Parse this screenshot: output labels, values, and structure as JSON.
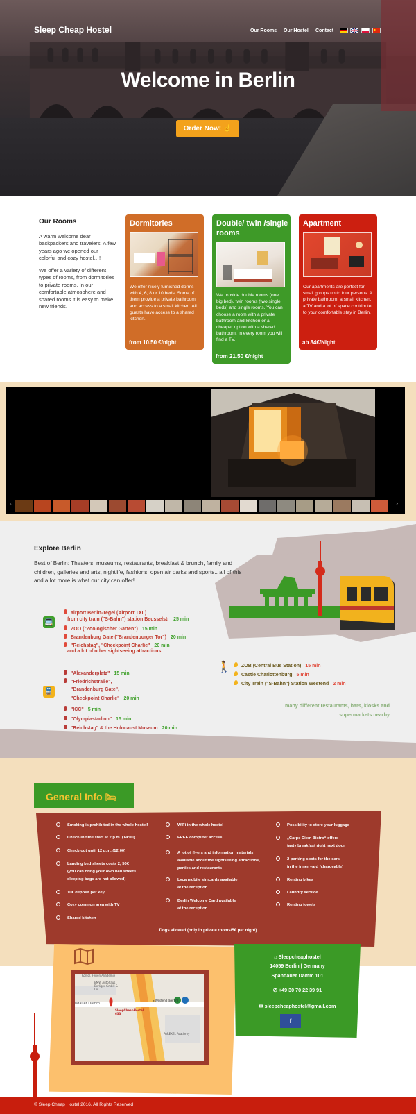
{
  "header": {
    "brand": "Sleep Cheap Hostel",
    "nav": [
      "Our Rooms",
      "Our Hostel",
      "Contact"
    ],
    "flags": [
      {
        "icon": "german-flag-icon",
        "colors": [
          "#000000",
          "#dd0000",
          "#ffce00"
        ]
      },
      {
        "icon": "uk-flag-icon",
        "colors": [
          "#012169",
          "#ffffff",
          "#c8102e"
        ]
      },
      {
        "icon": "polish-flag-icon",
        "colors": [
          "#ffffff",
          "#dc143c"
        ]
      },
      {
        "icon": "chinese-flag-icon",
        "colors": [
          "#de2910",
          "#ffde00"
        ]
      }
    ]
  },
  "hero": {
    "title": "Welcome in Berlin",
    "cta": "Order Now!",
    "cta_icon": "hand-pointer-icon",
    "cta_color": "#f3a21c"
  },
  "rooms": {
    "heading": "Our Rooms",
    "intro_1": "A warm welcome dear backpackers and travelers! A few years ago we opened our colorful and cozy hostel…!",
    "intro_2": "We offer a variety of different types of rooms, from dormitories to private rooms. In our comfortable atmosphere and shared rooms it is easy to make new friends.",
    "cards": [
      {
        "title": "Dormitories",
        "text": "We offer nicely furnished dorms with 4, 6, 8 or 10 beds. Some of them provide a private bathroom and access to a small kitchen. All guests have access to a shared kitchen.",
        "price": "from 10.50 €/night",
        "color": "#d06d28"
      },
      {
        "title": "Double/ twin /single rooms",
        "text": "We provide double rooms (one big bed), twin rooms (two single beds) and single rooms. You can choose a room with a private bathroom and kitchen or a cheaper option with a shared bathroom. In every room you will find a TV.",
        "price": "from 21.50 €/night",
        "color": "#3e9a28"
      },
      {
        "title": "Apartment",
        "text": "Our apartments are perfect for small groups up to four persons. A private bathroom, a small kitchen, a TV and a lot of space contribute to your comfortable stay in Berlin.",
        "price": "ab 84€/Night",
        "color": "#cc1f10"
      }
    ]
  },
  "gallery": {
    "prev_icon": "chevron-left-icon",
    "next_icon": "chevron-right-icon"
  },
  "explore": {
    "heading": "Explore Berlin",
    "text": "Best of Berlin: Theaters, museums, restaurants, breakfast & brunch, family and children, galleries and arts, nightlife, fashions, open air parks and sports.. all of this and a lot more is what our city can offer!",
    "group_a_icon": "bus-icon",
    "group_a": [
      {
        "place": "airport Berlin-Tegel (Airport TXL)",
        "time": ""
      },
      {
        "place": "from city train (\"S-Bahn\") station Beusselstr",
        "time": "25 min"
      },
      {
        "place": "ZOO (\"Zoologischer Garten\")",
        "time": "15 min"
      },
      {
        "place": "Brandenburg Gate (\"Brandenburger Tor\")",
        "time": "20 min"
      },
      {
        "place": "\"Reichstag\", \"Checkpoint Charlie\"",
        "time": "20 min"
      },
      {
        "place": "and a lot of other sightseeing attractions",
        "time": ""
      }
    ],
    "group_b_icon": "train-icon",
    "group_b": [
      {
        "place": "\"Alexanderplatz\"",
        "time": "15 min"
      },
      {
        "place": "\"Friedrichstraße\",",
        "time": ""
      },
      {
        "place": "\"Brandenburg Gate\",",
        "time": ""
      },
      {
        "place": "\"Checkpoint Charlie\"",
        "time": "20 min"
      },
      {
        "place": "\"ICC\"",
        "time": "5 min"
      },
      {
        "place": "\"Olympiastadion\"",
        "time": "15 min"
      },
      {
        "place": "\"Reichstag\" & the Holocaust Museum",
        "time": "20 min"
      }
    ],
    "group_c_icon": "walking-person-icon",
    "group_c": [
      {
        "place": "ZOB (Central Bus Station)",
        "time": "15 min"
      },
      {
        "place": "Castle Charlottenburg",
        "time": "5 min"
      },
      {
        "place": "City Train (\"S-Bahn\") Station Westend",
        "time": "2 min"
      }
    ],
    "nearby": "many different restaurants, bars, kiosks and supermarkets nearby"
  },
  "info": {
    "heading": "General Info",
    "heading_icon": "bed-icon",
    "col1": [
      "Smoking is prohibited in the whole hostel!",
      "Check-in time start at 2 p.m. (14:00)",
      "Check-out until 12 p.m. (12:00)",
      "Landing bed sheets costs 2, 50€",
      "(you can bring your own bed sheets",
      "sleeping bags are not allowed)",
      "10€ deposit per key",
      "Cozy common area with TV",
      "Shared kitchen"
    ],
    "col2": [
      "WiFi in the whole hostel",
      "FREE computer access",
      "A lot of flyers and information materials",
      "available about the sightseeing attractions,",
      "parties and restaurants",
      "Lyca mobile simcards available",
      "at the reception",
      "Berlin Welcome Card available",
      "at the reception"
    ],
    "col3": [
      "Possibility to store your luggage",
      "„Carpe Diem Bistro“ offers",
      "tasty breakfast right next door",
      "2 parking spots for the cars",
      "in the inner yard (chargeable)",
      "Renting bikes",
      "Laundry service",
      "Renting towels"
    ],
    "dogs": "Dogs allowed (only in private rooms/5€ per night)"
  },
  "contact": {
    "map_icon": "map-icon",
    "name": "Sleepcheaphostel",
    "city": "14059 Berlin | Germany",
    "street": "Spandauer Damm 101",
    "phone": "+49 30 70 22 39 91",
    "email": "sleepcheaphostel@gmail.com",
    "facebook": "f",
    "map_labels": {
      "akademie": "Königl. Ferien-Akademie",
      "bmw": "BMW Autohaus Berliger GmbH & Co",
      "road": "ndauer Damm",
      "station": "S Westend (Berlin)",
      "pin": "SleepCheapHostel 633",
      "parexel": "PAREXEL Academy"
    }
  },
  "footer": {
    "text": "© Sleep Cheap Hostel 2016, All Rights Reserved"
  }
}
